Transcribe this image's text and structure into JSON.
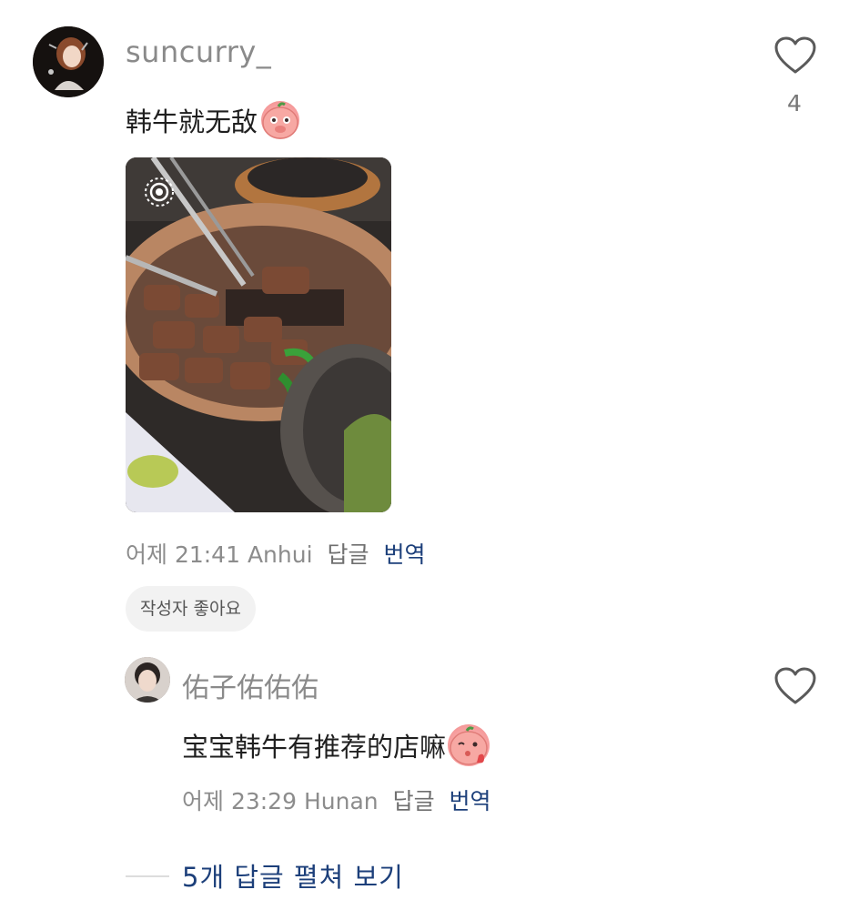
{
  "comment": {
    "username": "suncurry_",
    "text": "韩牛就无敌",
    "emoji": "shy-peach-emoji",
    "likes": "4",
    "image": {
      "description_icon": "live-photo-icon"
    },
    "meta": {
      "time": "어제 21:41",
      "location": "Anhui",
      "reply_label": "답글",
      "translate_label": "번역"
    },
    "author_liked_label": "작성자 좋아요"
  },
  "reply": {
    "username": "佑子佑佑佑",
    "text": "宝宝韩牛有推荐的店嘛",
    "emoji": "kiss-peach-emoji",
    "meta": {
      "time": "어제 23:29",
      "location": "Hunan",
      "reply_label": "답글",
      "translate_label": "번역"
    }
  },
  "expand_replies_label": "5개 답글 펼쳐 보기",
  "colors": {
    "link_blue": "#1c3f7a",
    "muted_gray": "#8c8c8c"
  }
}
